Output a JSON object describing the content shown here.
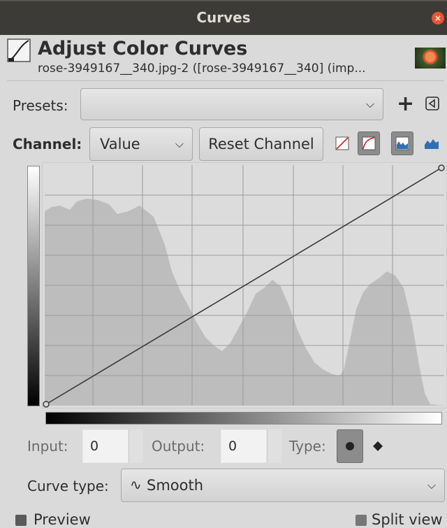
{
  "window": {
    "title": "Curves",
    "close_label": "×"
  },
  "header": {
    "title": "Adjust Color Curves",
    "subtitle": "rose-3949167__340.jpg-2 ([rose-3949167__340] (imp..."
  },
  "presets": {
    "label": "Presets:",
    "value": "",
    "add_label": "+"
  },
  "channel": {
    "label": "Channel:",
    "value": "Value",
    "reset_label": "Reset Channel"
  },
  "curve": {
    "points": [
      [
        0,
        0
      ],
      [
        255,
        255
      ]
    ],
    "line_color": "#3a3a3a",
    "histogram_color": "#bdbdbd"
  },
  "inputs": {
    "input_label": "Input:",
    "input_value": "0",
    "output_label": "Output:",
    "output_value": "0",
    "type_label": "Type:"
  },
  "curve_type": {
    "label": "Curve type:",
    "value": "Smooth",
    "icon": "∿"
  },
  "footer": {
    "preview_label": "Preview",
    "split_label": "Split view"
  },
  "colors": {
    "titlebar": "#3c3b37",
    "close": "#e9542f",
    "graph_bg": "#dcdcdc",
    "active_toggle": "#8c8c8c"
  }
}
